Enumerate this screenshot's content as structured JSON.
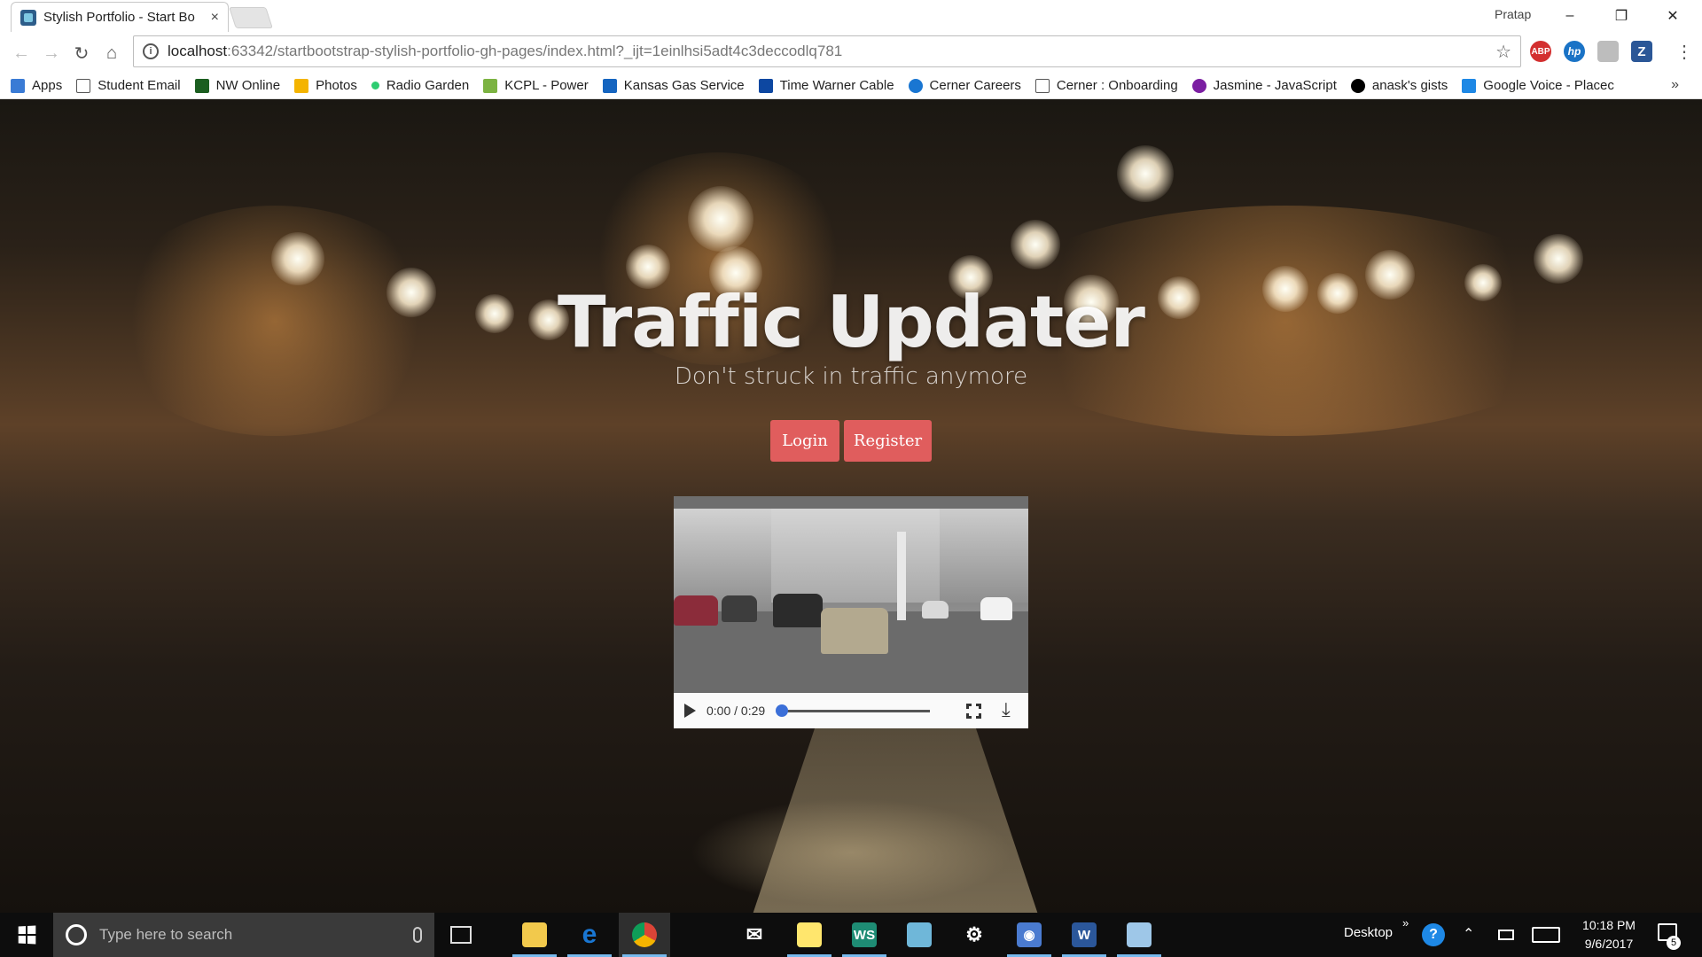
{
  "browser": {
    "tab_title": "Stylish Portfolio - Start Bo",
    "tab_close": "×",
    "profile_name": "Pratap",
    "url_host": "localhost",
    "url_rest": ":63342/startbootstrap-stylish-portfolio-gh-pages/index.html?_ijt=1einlhsi5adt4c3deccodlq781",
    "window_controls": {
      "minimize": "–",
      "restore": "❐",
      "close": "✕"
    },
    "extensions": [
      {
        "name": "abp-icon",
        "label": "ABP",
        "color": "#d32f2f"
      },
      {
        "name": "hp-icon",
        "label": "hp",
        "color": "#1a73c6"
      },
      {
        "name": "puzzle-icon",
        "label": "",
        "color": "#9e9e9e"
      },
      {
        "name": "zotero-icon",
        "label": "Z",
        "color": "#2b5797"
      }
    ]
  },
  "bookmarks": [
    {
      "name": "apps",
      "label": "Apps",
      "icon": "apps-grid-icon",
      "color": "#3a7bd5"
    },
    {
      "name": "student-email",
      "label": "Student Email",
      "icon": "page-icon",
      "color": "#555"
    },
    {
      "name": "nw-online",
      "label": "NW Online",
      "icon": "n-icon",
      "color": "#1b5e20"
    },
    {
      "name": "photos",
      "label": "Photos",
      "icon": "pinwheel-icon",
      "color": "#f4b400"
    },
    {
      "name": "radio-garden",
      "label": "Radio Garden",
      "icon": "dot-icon",
      "color": "#2ecc71"
    },
    {
      "name": "kcpl-power",
      "label": "KCPL - Power",
      "icon": "leaf-icon",
      "color": "#7cb342"
    },
    {
      "name": "kansas-gas-service",
      "label": "Kansas Gas Service",
      "icon": "g-icon",
      "color": "#1565c0"
    },
    {
      "name": "time-warner-cable",
      "label": "Time Warner Cable",
      "icon": "play-icon",
      "color": "#0d47a1"
    },
    {
      "name": "cerner-careers",
      "label": "Cerner Careers",
      "icon": "sun-icon",
      "color": "#1976d2"
    },
    {
      "name": "cerner-onboarding",
      "label": "Cerner : Onboarding",
      "icon": "page-icon",
      "color": "#555"
    },
    {
      "name": "jasmine-javascript",
      "label": "Jasmine - JavaScript",
      "icon": "jasmine-icon",
      "color": "#7b1fa2"
    },
    {
      "name": "anask-gists",
      "label": "anask's gists",
      "icon": "github-icon",
      "color": "#000"
    },
    {
      "name": "google-voice",
      "label": "Google Voice - Placec",
      "icon": "phone-icon",
      "color": "#1e88e5"
    }
  ],
  "bookmarks_more": "»",
  "hero": {
    "title": "Traffic Updater",
    "subtitle": "Don't struck in traffic anymore",
    "login_label": "Login",
    "register_label": "Register",
    "button_color": "#e05d5d"
  },
  "video": {
    "time": "0:00 / 0:29",
    "progress": 0.0
  },
  "taskbar": {
    "search_placeholder": "Type here to search",
    "desktop_label": "Desktop",
    "overflow": "»",
    "time": "10:18 PM",
    "date": "9/6/2017",
    "notification_count": "5",
    "apps": [
      {
        "name": "file-explorer-icon",
        "glyph": "",
        "color": "#f2c94c"
      },
      {
        "name": "edge-icon",
        "glyph": "e",
        "color": "#1976d2"
      },
      {
        "name": "chrome-icon",
        "glyph": "",
        "color": "#34a853"
      },
      {
        "name": "store-icon",
        "glyph": "",
        "color": "#ffffff"
      },
      {
        "name": "mail-icon",
        "glyph": "✉",
        "color": "#ffffff"
      },
      {
        "name": "sticky-notes-icon",
        "glyph": "",
        "color": "#ffe66d"
      },
      {
        "name": "webstorm-icon",
        "glyph": "WS",
        "color": "#1e8c74"
      },
      {
        "name": "app-blue-icon",
        "glyph": "",
        "color": "#6fb7d9"
      },
      {
        "name": "settings-icon",
        "glyph": "⚙",
        "color": "#ffffff"
      },
      {
        "name": "app-circle-icon",
        "glyph": "◉",
        "color": "#4a7bd0"
      },
      {
        "name": "word-icon",
        "glyph": "W",
        "color": "#2b579a"
      },
      {
        "name": "paint-icon",
        "glyph": "",
        "color": "#9ec7e8"
      }
    ]
  }
}
